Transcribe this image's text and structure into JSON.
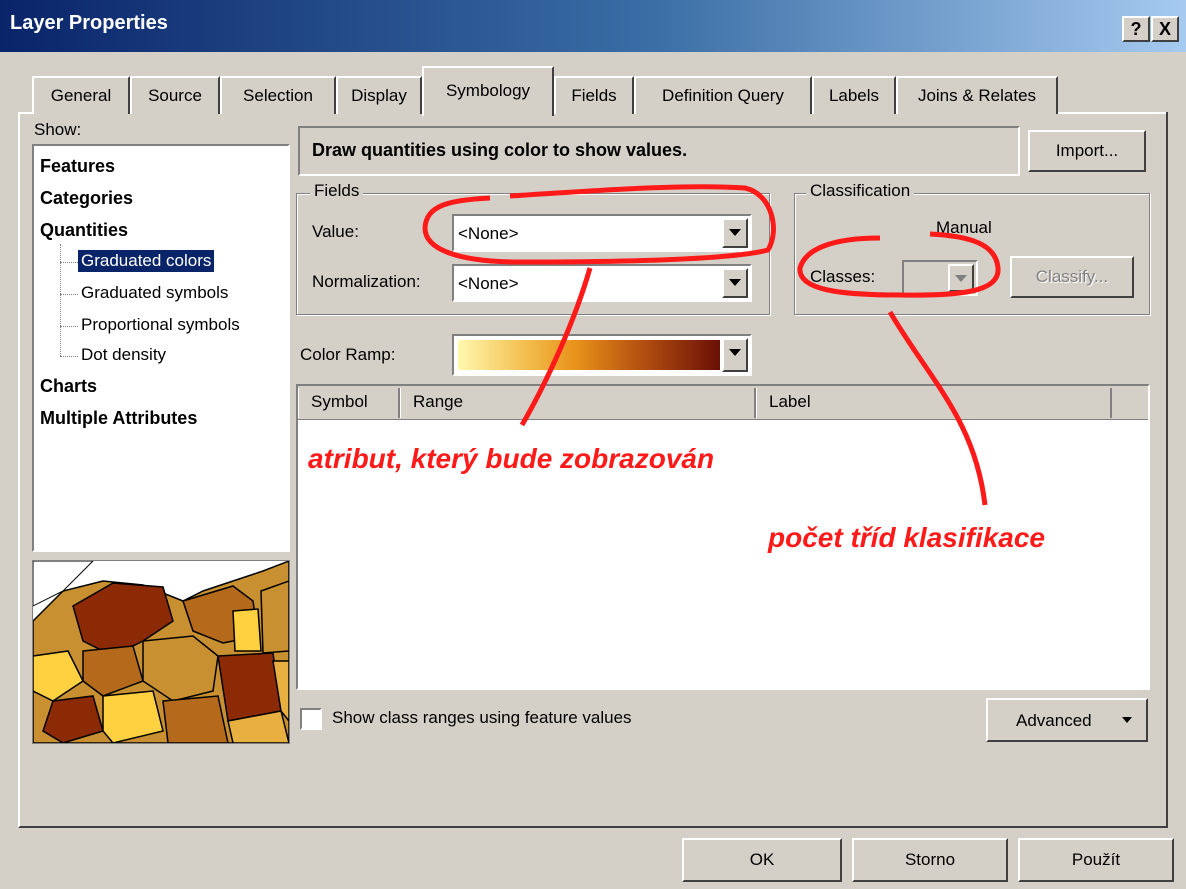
{
  "window": {
    "title": "Layer Properties",
    "help_btn": "?",
    "close_btn": "X"
  },
  "tabs": [
    "General",
    "Source",
    "Selection",
    "Display",
    "Symbology",
    "Fields",
    "Definition Query",
    "Labels",
    "Joins & Relates"
  ],
  "active_tab": "Symbology",
  "show": {
    "label": "Show:",
    "items": [
      "Features",
      "Categories",
      "Quantities",
      "Graduated colors",
      "Graduated symbols",
      "Proportional symbols",
      "Dot density",
      "Charts",
      "Multiple Attributes"
    ],
    "selected": "Graduated colors"
  },
  "description": "Draw quantities using color to show values.",
  "import_btn": "Import...",
  "fields": {
    "legend": "Fields",
    "value_label": "Value:",
    "value": "<None>",
    "normalization_label": "Normalization:",
    "normalization": "<None>"
  },
  "classification": {
    "legend": "Classification",
    "method": "Manual",
    "classes_label": "Classes:",
    "classify_btn": "Classify..."
  },
  "color_ramp_label": "Color Ramp:",
  "table": {
    "headers": [
      "Symbol",
      "Range",
      "Label"
    ]
  },
  "show_class_ranges": {
    "label": "Show class ranges using feature values",
    "checked": false
  },
  "advanced_btn": "Advanced",
  "buttons": {
    "ok": "OK",
    "cancel": "Storno",
    "apply": "Použít"
  },
  "annotations": {
    "attribute": "atribut, který bude zobrazován",
    "classes": "počet tříd klasifikace"
  },
  "colors": {
    "annotation": "#ff1a1a",
    "title_bar": "#0a246a",
    "selection": "#0a246a"
  }
}
